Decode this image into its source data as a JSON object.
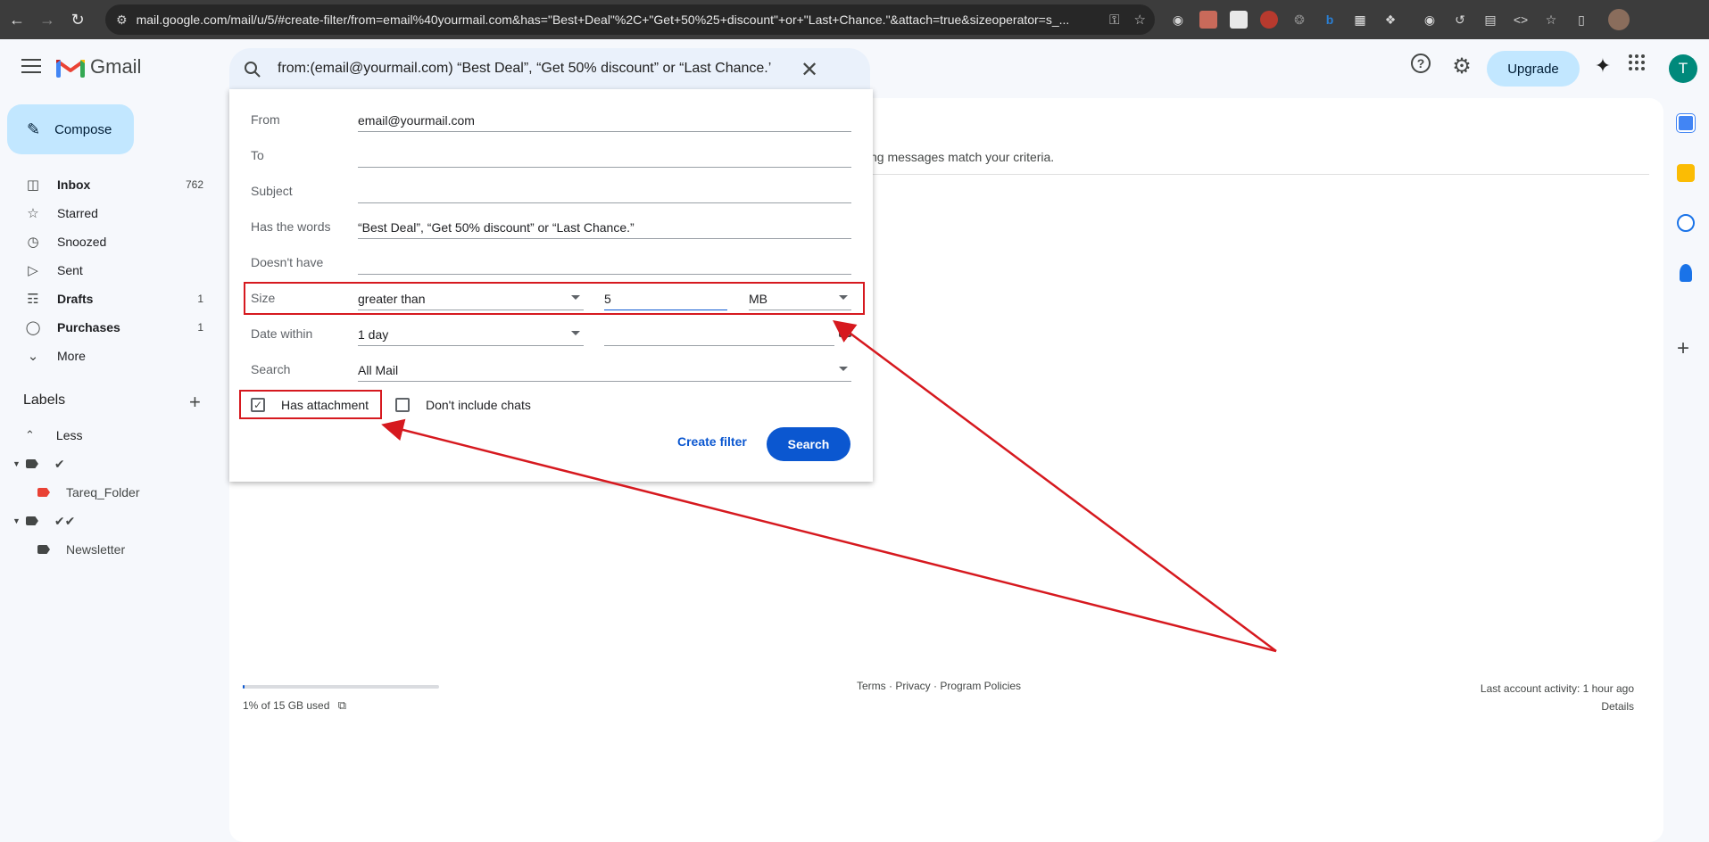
{
  "browser": {
    "url": "mail.google.com/mail/u/5/#create-filter/from=email%40yourmail.com&has=\"Best+Deal\"%2C+\"Get+50%25+discount\"+or+\"Last+Chance.\"&attach=true&sizeoperator=s_..."
  },
  "app": {
    "name": "Gmail"
  },
  "search": {
    "query": "from:(email@yourmail.com) “Best Deal”, “Get 50% discount” or “Last Chance.’"
  },
  "header": {
    "upgrade_label": "Upgrade",
    "avatar_letter": "T"
  },
  "compose": {
    "label": "Compose"
  },
  "nav": [
    {
      "label": "Inbox",
      "count": "762",
      "icon": "inbox-icon"
    },
    {
      "label": "Starred",
      "count": "",
      "icon": "star-icon"
    },
    {
      "label": "Snoozed",
      "count": "",
      "icon": "clock-icon"
    },
    {
      "label": "Sent",
      "count": "",
      "icon": "send-icon"
    },
    {
      "label": "Drafts",
      "count": "1",
      "icon": "draft-icon"
    },
    {
      "label": "Purchases",
      "count": "1",
      "icon": "tag-icon"
    },
    {
      "label": "More",
      "count": "",
      "icon": "chevron-down-icon"
    }
  ],
  "labels": {
    "title": "Labels",
    "less": "Less",
    "items": [
      {
        "label": "✔",
        "color": "#444746"
      },
      {
        "label": "Tareq_Folder",
        "color": "#e94235"
      },
      {
        "label": "✔✔",
        "color": "#444746"
      },
      {
        "label": "Newsletter",
        "color": "#444746"
      }
    ]
  },
  "dialog": {
    "from_label": "From",
    "from_value": "email@yourmail.com",
    "to_label": "To",
    "to_value": "",
    "subject_label": "Subject",
    "subject_value": "",
    "has_words_label": "Has the words",
    "has_words_value": " “Best Deal”, “Get 50% discount” or “Last Chance.”",
    "doesnt_have_label": "Doesn't have",
    "doesnt_have_value": "",
    "size_label": "Size",
    "size_operator": "greater than",
    "size_value": "5",
    "size_unit": "MB",
    "date_label": "Date within",
    "date_value": "1 day",
    "search_label": "Search",
    "search_value": "All Mail",
    "has_attachment_label": "Has attachment",
    "has_attachment_checked": true,
    "no_chats_label": "Don't include chats",
    "no_chats_checked": false,
    "create_filter_label": "Create filter",
    "search_button_label": "Search"
  },
  "main": {
    "criteria_text": "ng messages match your criteria.",
    "storage_text": "1% of 15 GB used",
    "storage_percent": 1,
    "footer_links": "Terms · Privacy · Program Policies",
    "activity_text": "Last account activity: 1 hour ago",
    "details_text": "Details"
  },
  "annotation_color": "#d6191f"
}
